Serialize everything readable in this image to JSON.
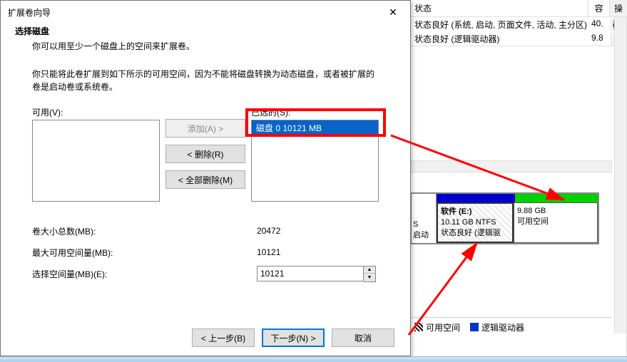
{
  "dialog": {
    "title": "扩展卷向导",
    "header_title": "选择磁盘",
    "header_subtitle": "你可以用至少一个磁盘上的空间来扩展卷。",
    "description": "你只能将此卷扩展到如下所示的可用空间，因为不能将磁盘转换为动态磁盘，或者被扩展的卷是启动卷或系统卷。",
    "available_label": "可用(V):",
    "selected_label": "已选的(S):",
    "selected_item": "磁盘 0      10121 MB",
    "btn_add": "添加(A) >",
    "btn_remove": "< 删除(R)",
    "btn_remove_all": "< 全部删除(M)",
    "total_label": "卷大小总数(MB):",
    "total_value": "20472",
    "max_label": "最大可用空间量(MB):",
    "max_value": "10121",
    "sel_label": "选择空间量(MB)(E):",
    "sel_value": "10121",
    "btn_back": "< 上一步(B)",
    "btn_next": "下一步(N) >",
    "btn_cancel": "取消"
  },
  "bg": {
    "col_state": "状态",
    "col_capacity": "容",
    "col_ops": "操",
    "row1_state": "状态良好 (系统, 启动, 页面文件, 活动, 主分区)",
    "row1_cap": "40.",
    "row1_ops": "磁",
    "row2_state": "状态良好 (逻辑驱动器)",
    "row2_cap": "9.8",
    "partition_left_line1": "S",
    "partition_left_line2": "启动",
    "part1_title": "软件   (E:)",
    "part1_line2": "10.11 GB NTFS",
    "part1_line3": "状态良好 (逻辑驱",
    "part2_line1": "9.88 GB",
    "part2_line2": "可用空间",
    "legend1": "可用空间",
    "legend2": "逻辑驱动器"
  }
}
